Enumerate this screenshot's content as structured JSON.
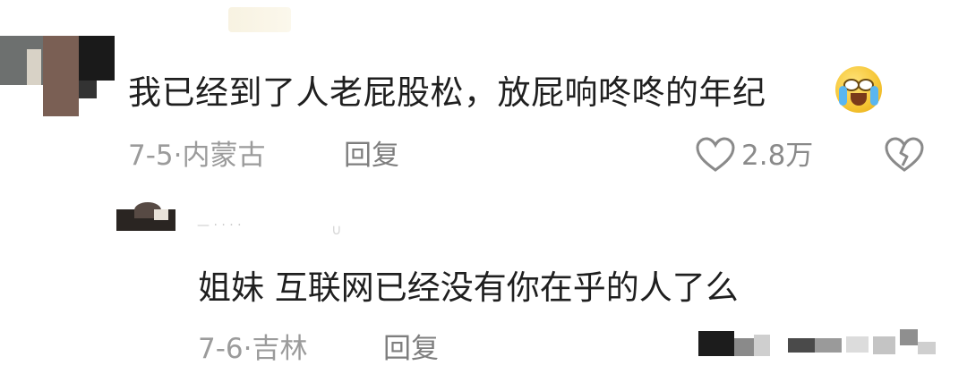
{
  "comments": [
    {
      "text": "我已经到了人老屁股松，放屁响咚咚的年纪",
      "emoji": "crying-laughing-emoji",
      "date": "7-5",
      "location": "内蒙古",
      "reply_label": "回复",
      "likes": "2.8万"
    },
    {
      "text": "姐妹 互联网已经没有你在乎的人了么",
      "date": "7-6",
      "location": "吉林",
      "reply_label": "回复"
    }
  ],
  "colors": {
    "text": "#1f1f1f",
    "meta": "#9b9b9b",
    "icon": "#8a8a8a"
  },
  "icons": [
    "heart-icon",
    "broken-heart-icon"
  ]
}
